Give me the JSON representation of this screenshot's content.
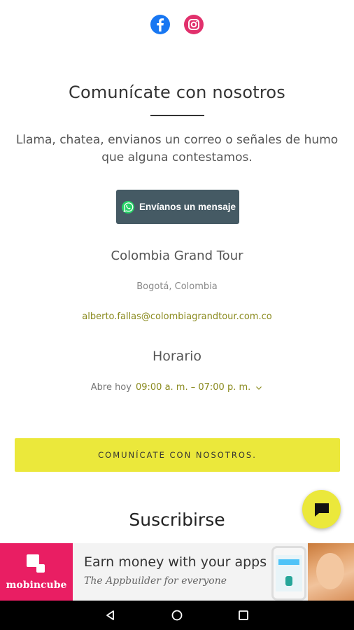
{
  "social": {
    "facebook_icon": "facebook-icon",
    "instagram_icon": "instagram-icon",
    "colors": {
      "facebook": "#1877f2",
      "instagram": "#e1306c"
    }
  },
  "contact": {
    "title": "Comunícate con nosotros",
    "description": "Llama, chatea, envianos un correo o señales de humo que alguna contestamos.",
    "whatsapp_button_label": "Envíanos un mensaje",
    "company_name": "Colombia Grand Tour",
    "city": "Bogotá, Colombia",
    "email": "alberto.fallas@colombiagrandtour.com.co"
  },
  "hours": {
    "title": "Horario",
    "status_label": "Abre hoy",
    "value": "09:00 a. m. – 07:00 p. m."
  },
  "cta": {
    "label": "COMUNÍCATE CON NOSOTROS."
  },
  "subscribe": {
    "title": "Suscribirse"
  },
  "ad": {
    "brand": "mobincube",
    "headline": "Earn money with your apps",
    "tagline": "The Appbuilder for everyone"
  },
  "colors": {
    "accent": "#ebe83b",
    "button_dark": "#455a64",
    "ad_brand": "#e91e63"
  }
}
